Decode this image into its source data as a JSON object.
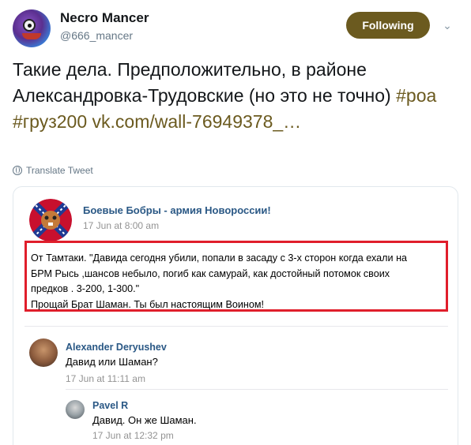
{
  "tweet": {
    "author_name": "Necro Mancer",
    "author_handle": "@666_mancer",
    "follow_label": "Following",
    "text_main": "Такие дела. Предположительно, в районе Александровка-Трудовские (но это не точно) ",
    "hashtag1": "#роа",
    "hashtag2": "#груз200",
    "link": "vk.com/wall-76949378_…",
    "translate_label": "Translate Tweet",
    "accent_color": "#6b5a1f"
  },
  "embed": {
    "group_name": "Боевые Бобры - армия Новороссии!",
    "post_date": "17 Jun at 8:00 am",
    "post_line1": "От Тамтаки. \"Давида сегодня убили, попали в засаду с 3-х сторон когда ехали на",
    "post_line2": "БРМ Рысь ,шансов небыло, погиб как самурай, как достойный потомок своих",
    "post_line3": "предков . 3-200, 1-300.\"",
    "post_line4": "Прощай Брат Шаман. Ты был настоящим Воином!",
    "highlight_color": "#e01e2b"
  },
  "comments": [
    {
      "name": "Alexander Deryushev",
      "text": "Давид или Шаман?",
      "date": "17 Jun at 11:11 am"
    },
    {
      "name": "Pavel R",
      "text": "Давид. Он же Шаман.",
      "date": "17 Jun at 12:32 pm"
    }
  ]
}
